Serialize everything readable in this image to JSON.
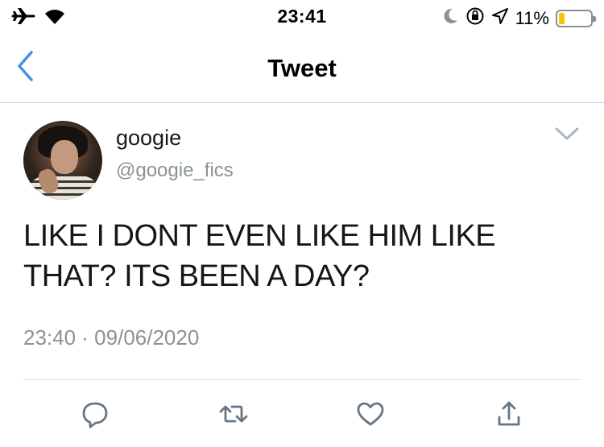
{
  "status_bar": {
    "time": "23:41",
    "battery_percent": "11%",
    "battery_level": 0.11,
    "icons": [
      "airplane-icon",
      "wifi-icon",
      "moon-icon",
      "orientation-lock-icon",
      "location-arrow-icon",
      "battery-icon"
    ]
  },
  "nav": {
    "title": "Tweet",
    "back_icon": "chevron-left-icon"
  },
  "tweet": {
    "display_name": "googie",
    "handle": "@googie_fics",
    "text": "LIKE I DONT EVEN LIKE HIM LIKE THAT? ITS BEEN A DAY?",
    "timestamp": "23:40 · 09/06/2020",
    "menu_icon": "chevron-down-icon"
  },
  "actions": [
    "reply-icon",
    "retweet-icon",
    "like-icon",
    "share-icon"
  ],
  "colors": {
    "accent": "#4a90e2",
    "secondary_text": "#8a9298",
    "icon": "#657786",
    "battery": "#f4c20d"
  }
}
